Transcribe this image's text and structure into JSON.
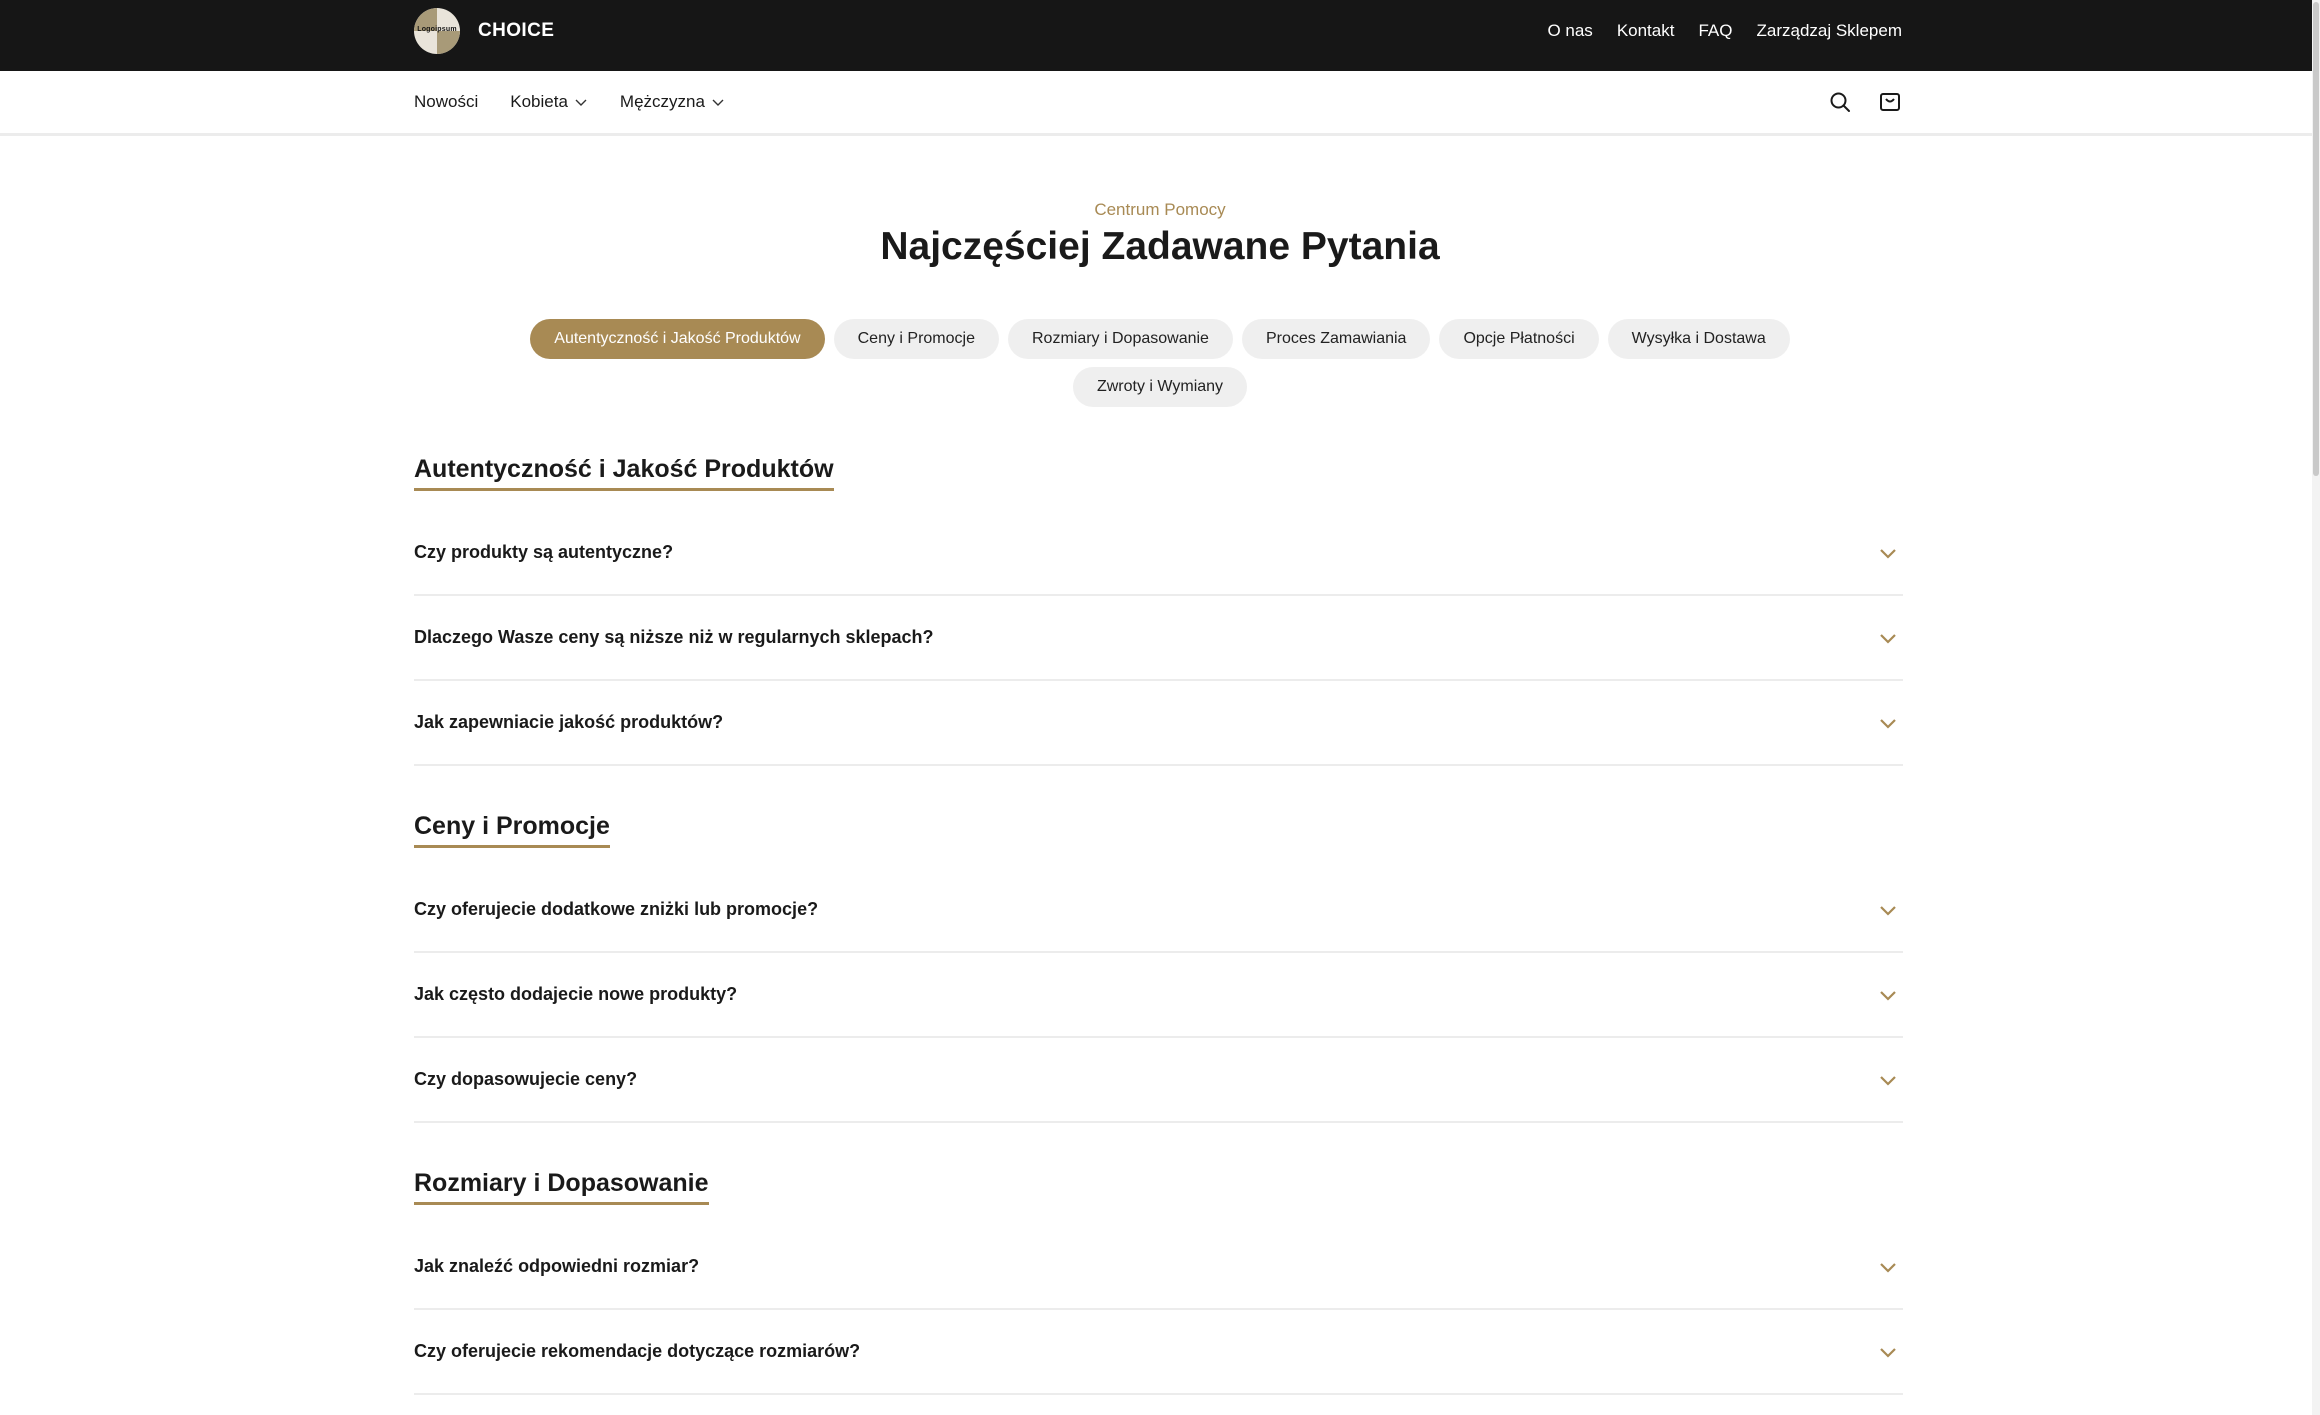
{
  "brand": {
    "logo_text": "Logoipsum",
    "name": "CHOICE"
  },
  "top_nav": {
    "links": [
      "O nas",
      "Kontakt",
      "FAQ",
      "Zarządzaj Sklepem"
    ]
  },
  "main_nav": {
    "items": [
      {
        "label": "Nowości",
        "dropdown": false
      },
      {
        "label": "Kobieta",
        "dropdown": true
      },
      {
        "label": "Mężczyzna",
        "dropdown": true
      }
    ],
    "icons": [
      "search-icon",
      "cart-icon"
    ]
  },
  "hero": {
    "eyebrow": "Centrum Pomocy",
    "title": "Najczęściej Zadawane Pytania"
  },
  "categories": {
    "active_index": 0,
    "items": [
      "Autentyczność i Jakość Produktów",
      "Ceny i Promocje",
      "Rozmiary i Dopasowanie",
      "Proces Zamawiania",
      "Opcje Płatności",
      "Wysyłka i Dostawa",
      "Zwroty i Wymiany"
    ]
  },
  "sections": [
    {
      "title": "Autentyczność i Jakość Produktów",
      "questions": [
        "Czy produkty są autentyczne?",
        "Dlaczego Wasze ceny są niższe niż w regularnych sklepach?",
        "Jak zapewniacie jakość produktów?"
      ]
    },
    {
      "title": "Ceny i Promocje",
      "questions": [
        "Czy oferujecie dodatkowe zniżki lub promocje?",
        "Jak często dodajecie nowe produkty?",
        "Czy dopasowujecie ceny?"
      ]
    },
    {
      "title": "Rozmiary i Dopasowanie",
      "questions": [
        "Jak znaleźć odpowiedni rozmiar?",
        "Czy oferujecie rekomendacje dotyczące rozmiarów?"
      ]
    }
  ],
  "colors": {
    "accent": "#a88a54",
    "topbar": "#161616",
    "pill_bg": "#efefef"
  }
}
